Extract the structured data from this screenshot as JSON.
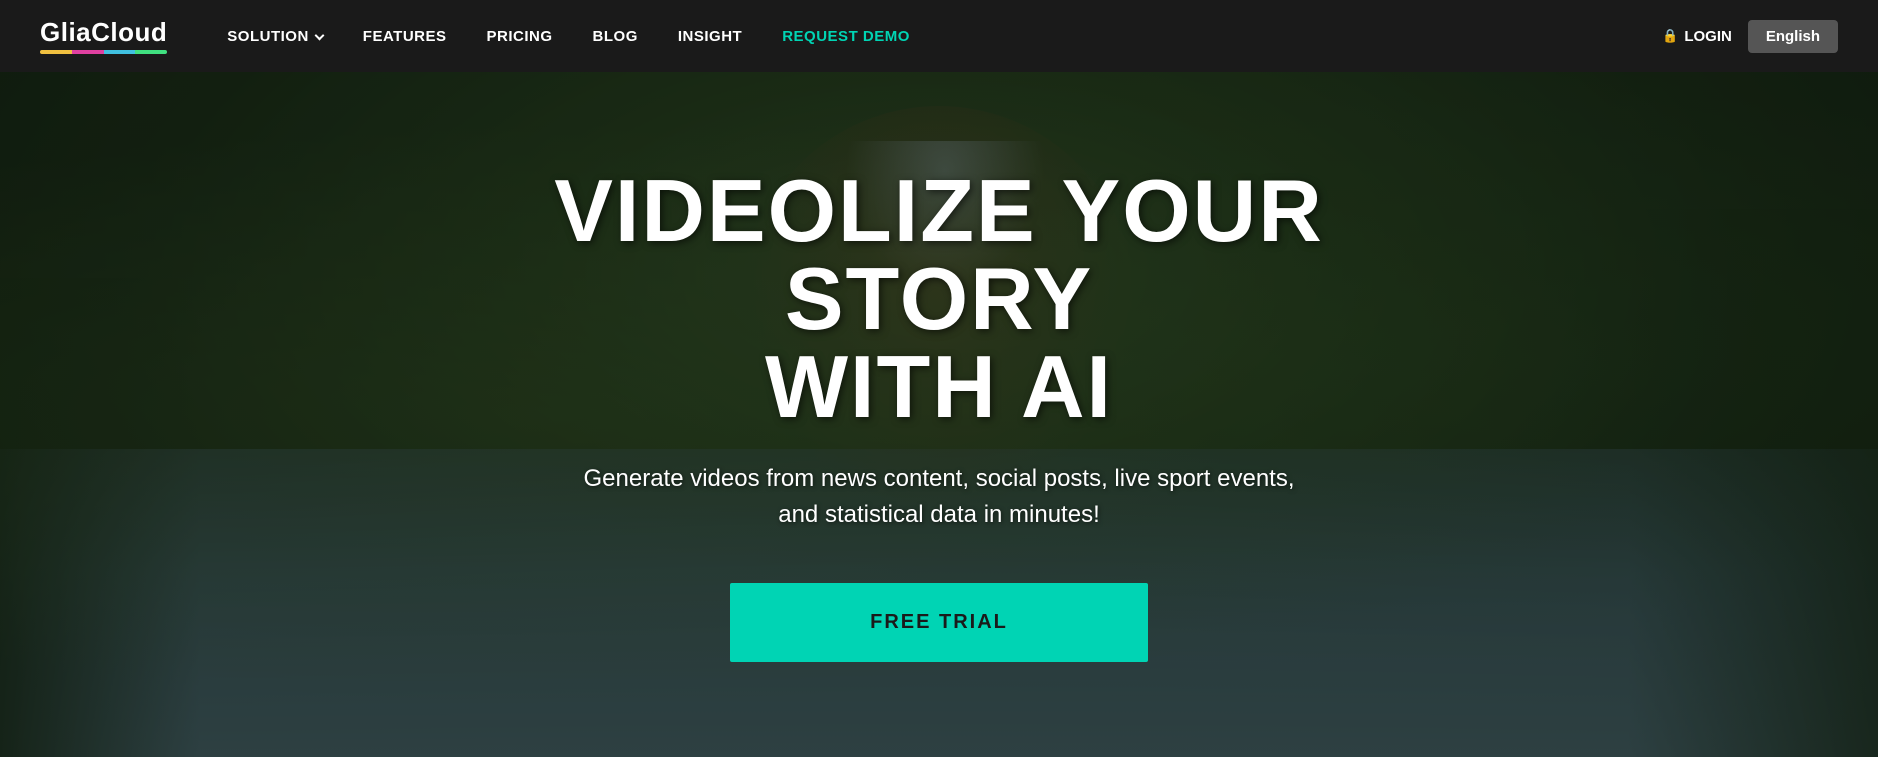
{
  "navbar": {
    "logo": {
      "text": "GliaCloud",
      "underline_colors": [
        "#f0c040",
        "#e040a0",
        "#40c0e0",
        "#40e080"
      ]
    },
    "nav_items": [
      {
        "label": "SOLUTION",
        "has_dropdown": true,
        "id": "solution"
      },
      {
        "label": "FEATURES",
        "has_dropdown": false,
        "id": "features"
      },
      {
        "label": "PRICING",
        "has_dropdown": false,
        "id": "pricing"
      },
      {
        "label": "BLOG",
        "has_dropdown": false,
        "id": "blog"
      },
      {
        "label": "INSIGHT",
        "has_dropdown": false,
        "id": "insight"
      },
      {
        "label": "REQUEST DEMO",
        "has_dropdown": false,
        "id": "request-demo",
        "highlight": true
      }
    ],
    "login_label": "LOGIN",
    "language_label": "English"
  },
  "hero": {
    "title_line1": "VIDEOLIZE YOUR STORY",
    "title_line2": "WITH AI",
    "subtitle": "Generate videos from news content, social posts, live sport events,\nand statistical data in minutes!",
    "cta_label": "FREE TRIAL"
  }
}
